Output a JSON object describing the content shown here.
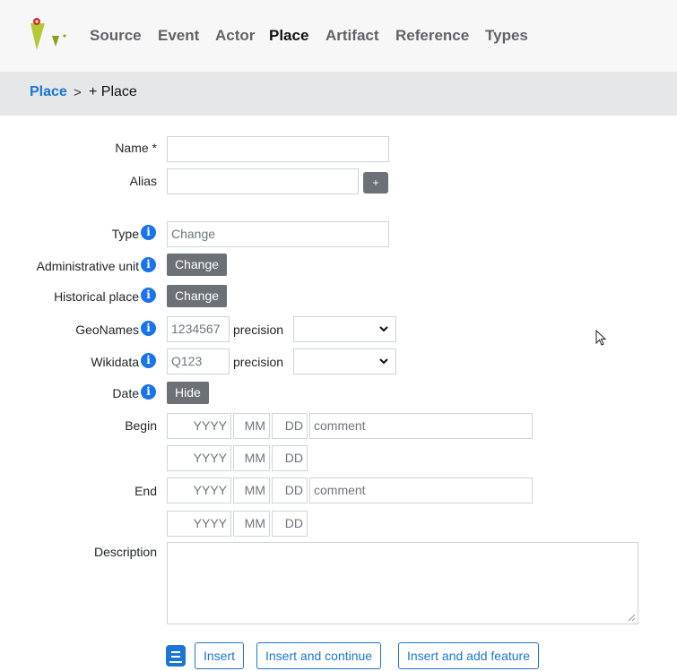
{
  "nav": {
    "items": [
      "Source",
      "Event",
      "Actor",
      "Place",
      "Artifact",
      "Reference",
      "Types"
    ],
    "active": "Place"
  },
  "breadcrumb": {
    "parent": "Place",
    "separator": ">",
    "current": "+ Place"
  },
  "form": {
    "name_label": "Name *",
    "alias_label": "Alias",
    "alias_add": "+",
    "type_label": "Type",
    "type_placeholder": "Change",
    "admin_label": "Administrative unit",
    "admin_button": "Change",
    "historical_label": "Historical place",
    "historical_button": "Change",
    "geonames_label": "GeoNames",
    "geonames_placeholder": "1234567",
    "wikidata_label": "Wikidata",
    "wikidata_placeholder": "Q123",
    "precision_label": "precision",
    "date_label": "Date",
    "date_button": "Hide",
    "begin_label": "Begin",
    "end_label": "End",
    "year_placeholder": "YYYY",
    "month_placeholder": "MM",
    "day_placeholder": "DD",
    "comment_placeholder": "comment",
    "description_label": "Description",
    "info_glyph": "i"
  },
  "actions": {
    "insert": "Insert",
    "insert_continue": "Insert and continue",
    "insert_feature": "Insert and add feature"
  },
  "colors": {
    "accent": "#1a76d2",
    "button_gray": "#6b7176",
    "logo_green": "#b5c934"
  }
}
